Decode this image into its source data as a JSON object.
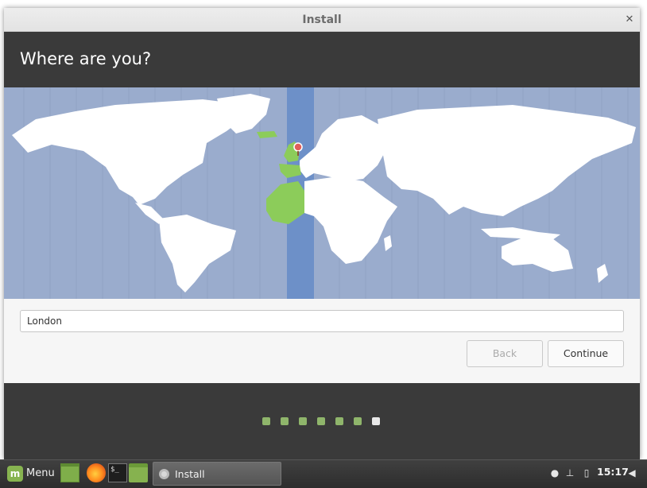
{
  "window": {
    "title": "Install",
    "close_glyph": "✕"
  },
  "page": {
    "heading": "Where are you?"
  },
  "map": {
    "selected_city": "London",
    "colors": {
      "ocean": "#9aaccd",
      "land": "#ffffff",
      "selected_zone": "#6d90c8",
      "highlighted_land": "#8ccc5a",
      "pin": "#e0605a"
    }
  },
  "timezone_field": {
    "value": "London"
  },
  "buttons": {
    "back_label": "Back",
    "continue_label": "Continue"
  },
  "progress": {
    "total_steps": 7,
    "current_step": 7
  },
  "taskbar": {
    "menu_label": "Menu",
    "window_button_label": "Install",
    "clock": "15:17",
    "icons": [
      "mint-logo-icon",
      "show-desktop-icon",
      "firefox-icon",
      "terminal-icon",
      "files-icon",
      "cd-icon",
      "user-icon",
      "network-icon",
      "battery-icon",
      "volume-icon"
    ]
  }
}
